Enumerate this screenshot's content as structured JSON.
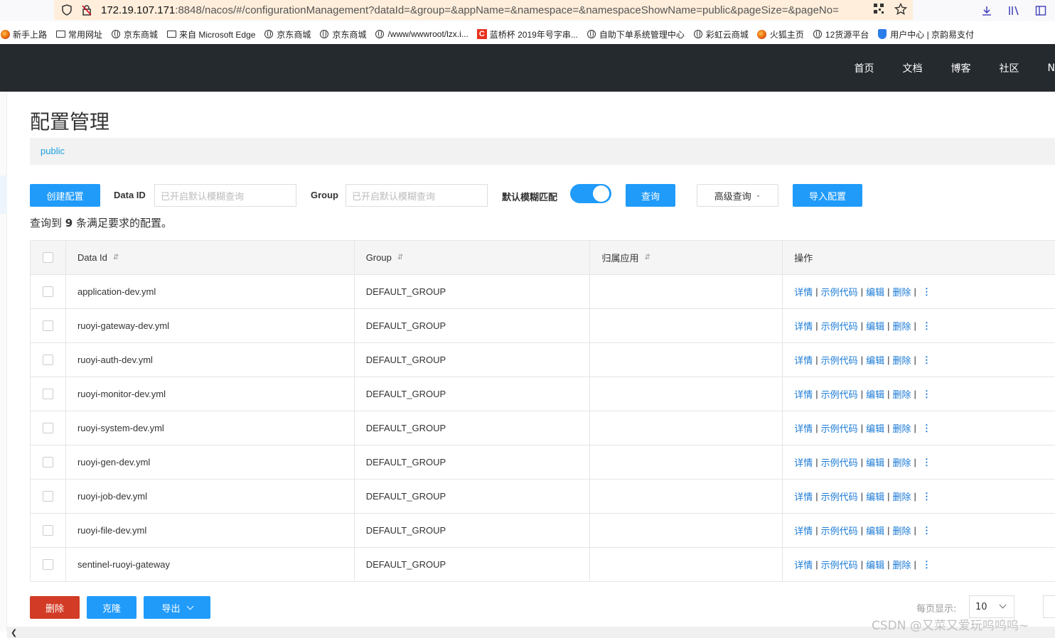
{
  "browser": {
    "url_host": "172.19.107.171",
    "url_rest": ":8848/nacos/#/configurationManagement?dataId=&group=&appName=&namespace=&namespaceShowName=public&pageSize=&pageNo=",
    "bookmarks": [
      {
        "label": "新手上路",
        "icon": "firefox-icon"
      },
      {
        "label": "常用网址",
        "icon": "folder-icon"
      },
      {
        "label": "京东商城",
        "icon": "globe-icon"
      },
      {
        "label": "来自 Microsoft Edge",
        "icon": "folder-icon"
      },
      {
        "label": "京东商城",
        "icon": "globe-icon"
      },
      {
        "label": "京东商城",
        "icon": "globe-icon"
      },
      {
        "label": "/www/wwwroot/lzx.i...",
        "icon": "globe-icon"
      },
      {
        "label": "蓝桥杯 2019年号字串...",
        "icon": "csdn-icon"
      },
      {
        "label": "自助下单系统管理中心",
        "icon": "globe-icon"
      },
      {
        "label": "彩虹云商城",
        "icon": "globe-icon"
      },
      {
        "label": "火狐主页",
        "icon": "firefox-icon"
      },
      {
        "label": "12货源平台",
        "icon": "globe-icon"
      },
      {
        "label": "用户中心 | 京韵易支付",
        "icon": "shield-icon"
      }
    ]
  },
  "topnav": {
    "links": [
      "首页",
      "文档",
      "博客",
      "社区",
      "N"
    ]
  },
  "page": {
    "title": "配置管理",
    "namespace": "public"
  },
  "toolbar": {
    "create_label": "创建配置",
    "dataid_label": "Data ID",
    "dataid_placeholder": "已开启默认模糊查询",
    "group_label": "Group",
    "group_placeholder": "已开启默认模糊查询",
    "fuzzy_label": "默认模糊匹配",
    "fuzzy_on": true,
    "query_label": "查询",
    "advanced_label": "高级查询",
    "import_label": "导入配置"
  },
  "summary": {
    "prefix": "查询到",
    "count": "9",
    "suffix": "条满足要求的配置。"
  },
  "table": {
    "headers": {
      "dataid": "Data Id",
      "group": "Group",
      "app": "归属应用",
      "ops": "操作"
    },
    "ops": {
      "detail": "详情",
      "sample": "示例代码",
      "edit": "编辑",
      "delete": "删除"
    },
    "rows": [
      {
        "dataid": "application-dev.yml",
        "group": "DEFAULT_GROUP",
        "app": ""
      },
      {
        "dataid": "ruoyi-gateway-dev.yml",
        "group": "DEFAULT_GROUP",
        "app": ""
      },
      {
        "dataid": "ruoyi-auth-dev.yml",
        "group": "DEFAULT_GROUP",
        "app": ""
      },
      {
        "dataid": "ruoyi-monitor-dev.yml",
        "group": "DEFAULT_GROUP",
        "app": ""
      },
      {
        "dataid": "ruoyi-system-dev.yml",
        "group": "DEFAULT_GROUP",
        "app": ""
      },
      {
        "dataid": "ruoyi-gen-dev.yml",
        "group": "DEFAULT_GROUP",
        "app": ""
      },
      {
        "dataid": "ruoyi-job-dev.yml",
        "group": "DEFAULT_GROUP",
        "app": ""
      },
      {
        "dataid": "ruoyi-file-dev.yml",
        "group": "DEFAULT_GROUP",
        "app": ""
      },
      {
        "dataid": "sentinel-ruoyi-gateway",
        "group": "DEFAULT_GROUP",
        "app": ""
      }
    ]
  },
  "footer": {
    "delete_label": "删除",
    "clone_label": "克隆",
    "export_label": "导出",
    "page_size_label": "每页显示:",
    "page_size": "10"
  },
  "watermark": "CSDN @又菜又爱玩呜呜呜~",
  "colors": {
    "primary": "#209bfa",
    "danger": "#d23c26",
    "nav_bg": "#252a2f",
    "link": "#1a7ad6"
  }
}
